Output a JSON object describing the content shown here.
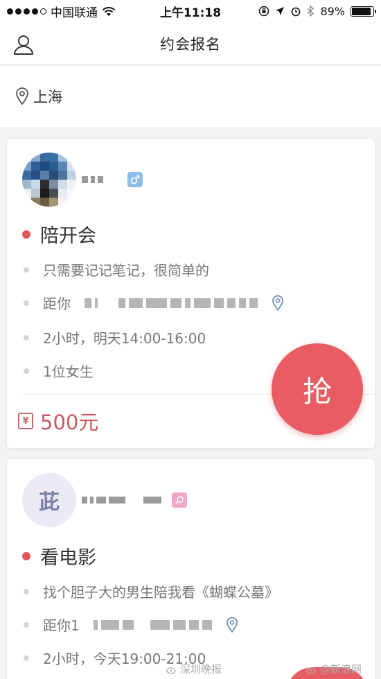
{
  "status_bar": {
    "carrier": "中国联通",
    "time": "上午11:18",
    "battery": "89%",
    "battery_level": 0.89
  },
  "nav": {
    "title": "约会报名"
  },
  "location": {
    "city": "上海"
  },
  "cards": [
    {
      "title": "陪开会",
      "description": "只需要记记笔记，很简单的",
      "distance_prefix": "距你",
      "time": "2小时，明天14:00-16:00",
      "people": "1位女生",
      "price_icon": "¥",
      "price": "500元",
      "grab_label": "抢"
    },
    {
      "avatar_initial": "茈",
      "title": "看电影",
      "description": "找个胆子大的男生陪我看《蝴蝶公墓》",
      "distance_prefix": "距你1",
      "time": "2小时，今天19:00-21:00"
    }
  ],
  "watermarks": {
    "left": "深圳晚报",
    "right": "@新浪网"
  },
  "colors": {
    "accent_red": "#e85d63",
    "price_red": "#c85a5f",
    "male_badge": "#8cbde6",
    "female_badge": "#f0a6c8"
  }
}
